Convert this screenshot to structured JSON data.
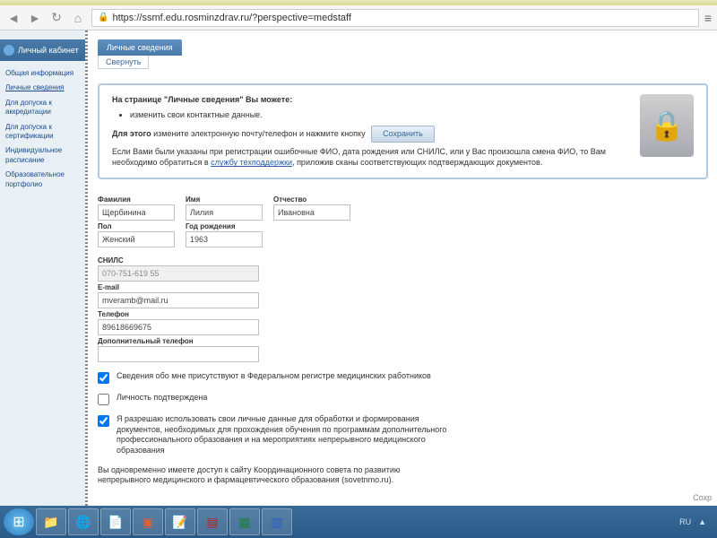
{
  "browser": {
    "url": "https://ssmf.edu.rosminzdrav.ru/?perspective=medstaff"
  },
  "sidebar": {
    "logo": "Личный кабинет",
    "items": [
      {
        "label": "Общая информация"
      },
      {
        "label": "Личные сведения"
      },
      {
        "label": "Для допуска к аккредитации"
      },
      {
        "label": "Для допуска к сертификации"
      },
      {
        "label": "Индивидуальное расписание"
      },
      {
        "label": "Образовательное портфолио"
      }
    ]
  },
  "page": {
    "tab": "Личные сведения",
    "collapse": "Свернуть"
  },
  "notice": {
    "title": "На странице \"Личные сведения\" Вы можете:",
    "bullet": "изменить свои контактные данные.",
    "line2_a": "Для этого",
    "line2_b": " измените электронную почту/телефон и нажмите кнопку",
    "save": "Сохранить",
    "line3_a": "Если Вами были указаны при регистрации ошибочные ФИО, дата рождения или СНИЛС, или у Вас произошла смена ФИО, то Вам необходимо обратиться в ",
    "line3_link": "службу техподдержки",
    "line3_b": ", приложив сканы соответствующих подтверждающих документов."
  },
  "form": {
    "lastname_label": "Фамилия",
    "lastname": "Щербинина",
    "firstname_label": "Имя",
    "firstname": "Лилия",
    "patronymic_label": "Отчество",
    "patronymic": "Ивановна",
    "sex_label": "Пол",
    "sex": "Женский",
    "birth_label": "Год рождения",
    "birth": "1963",
    "snils_label": "СНИЛС",
    "snils": "070-751-619 55",
    "email_label": "E-mail",
    "email": "mveramb@mail.ru",
    "phone_label": "Телефон",
    "phone": "89618669675",
    "phone2_label": "Дополнительный телефон"
  },
  "checks": {
    "c1": "Сведения обо мне присутствуют в Федеральном регистре медицинских работников",
    "c2": "Личность подтверждена",
    "c3": "Я разрешаю использовать свои личные данные для обработки и формирования документов, необходимых для прохождения обучения по программам дополнительного профессионального образования и на мероприятиях непрерывного медицинского образования"
  },
  "info": "Вы одновременно имеете доступ к сайту Координационного совета по развитию непрерывного медицинского и фармацевтического образования (sovetnmo.ru).",
  "footer": {
    "save_hint": "Сохр"
  },
  "tray": {
    "lang": "RU"
  }
}
